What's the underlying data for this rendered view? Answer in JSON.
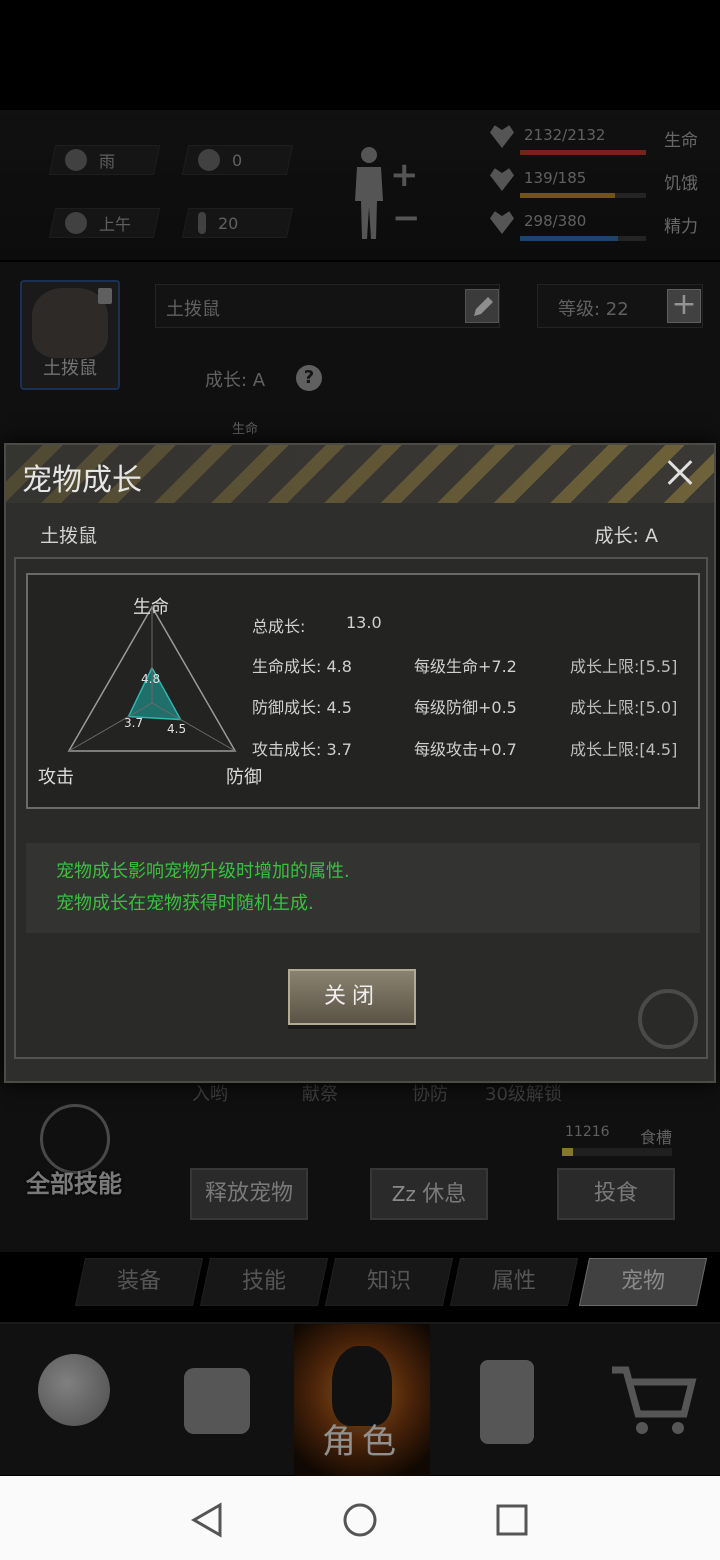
{
  "hud": {
    "weather": "雨",
    "radiation": "0",
    "time_of_day": "上午",
    "temperature": "20",
    "stats": [
      {
        "value": "2132/2132",
        "label": "生命",
        "fill": 1.0,
        "color": "#c0392b"
      },
      {
        "value": "139/185",
        "label": "饥饿",
        "fill": 0.75,
        "color": "#b8862b"
      },
      {
        "value": "298/380",
        "label": "精力",
        "fill": 0.78,
        "color": "#2f6fb0"
      }
    ]
  },
  "pet_panel": {
    "card_label": "土拨鼠",
    "name": "土拨鼠",
    "level": "等级:  22",
    "growth": "成长: A",
    "radar_label": "生命"
  },
  "skills_strip": [
    "入哟",
    "献祭",
    "协防",
    "30级解锁"
  ],
  "all_skills": "全部技能",
  "food": {
    "count": "11216",
    "label": "食槽",
    "fill": 0.1
  },
  "actions": {
    "release": "释放宠物",
    "rest": "休息",
    "feed": "投食"
  },
  "tabs": [
    "装备",
    "技能",
    "知识",
    "属性",
    "宠物"
  ],
  "nav": {
    "active_label": "角色"
  },
  "dialog": {
    "title": "宠物成长",
    "pet_name": "土拨鼠",
    "grade": "成长: A",
    "total": {
      "label": "总成长:",
      "value": "13.0"
    },
    "rows": [
      {
        "growth": "生命成长: 4.8",
        "per_level": "每级生命+7.2",
        "cap": "成长上限:[5.5]"
      },
      {
        "growth": "防御成长: 4.5",
        "per_level": "每级防御+0.5",
        "cap": "成长上限:[5.0]"
      },
      {
        "growth": "攻击成长: 3.7",
        "per_level": "每级攻击+0.7",
        "cap": "成长上限:[4.5]"
      }
    ],
    "info_lines": [
      "宠物成长影响宠物升级时增加的属性.",
      "宠物成长在宠物获得时随机生成."
    ],
    "close_label": "关闭"
  },
  "chart_data": {
    "type": "radar",
    "axes": [
      "生命",
      "防御",
      "攻击"
    ],
    "values": [
      4.8,
      4.5,
      3.7
    ],
    "max": [
      5.5,
      5.0,
      4.5
    ]
  }
}
